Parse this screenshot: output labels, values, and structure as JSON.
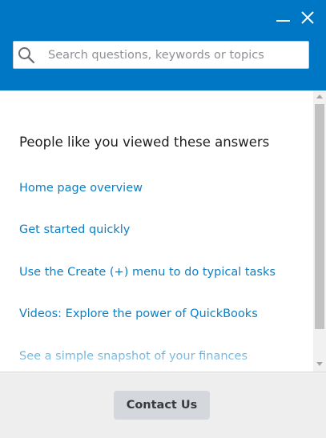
{
  "header": {
    "background_color": "#0077c5",
    "minimize_icon": "minimize-icon",
    "close_icon": "close-icon"
  },
  "search": {
    "placeholder": "Search questions, keywords or topics",
    "value": "",
    "icon": "search-icon"
  },
  "content": {
    "title": "People like you viewed these answers",
    "links": [
      "Home page overview",
      "Get started quickly",
      "Use the Create (+) menu to do typical tasks",
      "Videos: Explore the power of QuickBooks",
      "See a simple snapshot of your finances"
    ],
    "link_color": "#0d7fc4"
  },
  "footer": {
    "contact_label": "Contact Us"
  }
}
